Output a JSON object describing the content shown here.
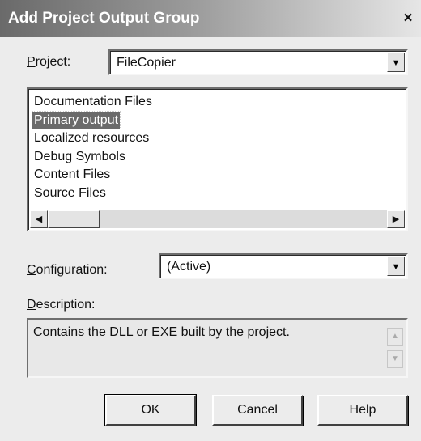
{
  "window": {
    "title": "Add Project Output Group",
    "close_glyph": "×"
  },
  "project": {
    "label_accel": "P",
    "label_rest": "roject:",
    "value": "FileCopier"
  },
  "output_groups": {
    "items": [
      "Documentation Files",
      "Primary output",
      "Localized resources",
      "Debug Symbols",
      "Content Files",
      "Source Files"
    ],
    "selected_index": 1
  },
  "configuration": {
    "label_accel": "C",
    "label_rest": "onfiguration:",
    "value": "(Active)"
  },
  "description": {
    "label_accel": "D",
    "label_rest": "escription:",
    "text": "Contains the DLL or EXE built by the project."
  },
  "buttons": {
    "ok": "OK",
    "cancel": "Cancel",
    "help": "Help"
  },
  "icons": {
    "dropdown_arrow": "▼",
    "scroll_left": "◀",
    "scroll_right": "▶",
    "scroll_up": "▲",
    "scroll_down": "▼"
  }
}
